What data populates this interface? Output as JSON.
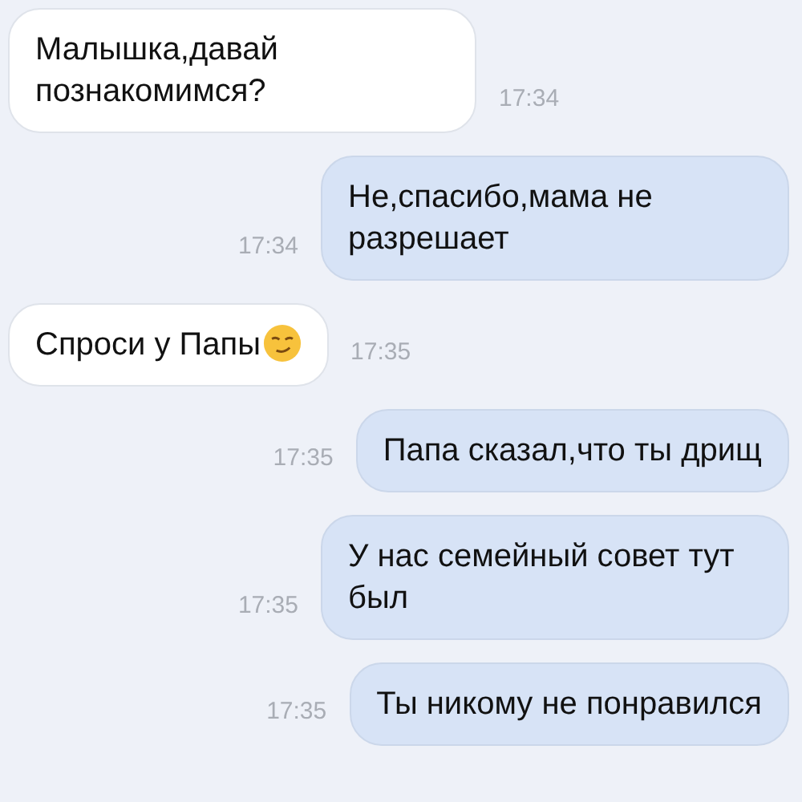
{
  "messages": [
    {
      "kind": "incoming",
      "text": "Малышка,давай познакомимся?",
      "time": "17:34"
    },
    {
      "kind": "outgoing",
      "text": "Не,спасибо,мама не разрешает",
      "time": "17:34"
    },
    {
      "kind": "incoming",
      "text": "Спроси у Папы",
      "time": "17:35",
      "emoji": true
    },
    {
      "kind": "outgoing",
      "text": "Папа сказал,что ты дрищ",
      "time": "17:35"
    },
    {
      "kind": "outgoing",
      "text": "У нас семейный совет тут был",
      "time": "17:35"
    },
    {
      "kind": "outgoing",
      "text": "Ты никому не понравился",
      "time": "17:35"
    }
  ]
}
